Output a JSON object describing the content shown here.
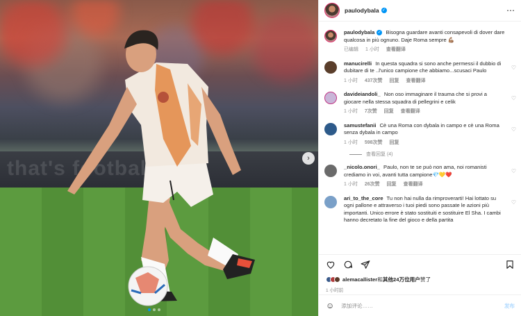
{
  "post": {
    "username": "paulodybala",
    "verified_mark": "✓",
    "more_icon": "more-horizontal-icon"
  },
  "photo": {
    "banner_text": "that's football...",
    "carousel_dots": 3,
    "active_dot": 1,
    "kit_colors": {
      "shirt": "#f2e9df",
      "accent": "#e07a2e",
      "shorts": "#f5f0ea",
      "socks": "#fafafa"
    }
  },
  "caption": {
    "user": "paulodybala",
    "text": "Bisogna guardare avanti consapevoli di dover dare qualcosa in più ognuno. Daje Roma sempre 💪🏽",
    "edited": "已编辑",
    "time": "1 小时",
    "translate": "查看翻译"
  },
  "comments": [
    {
      "user": "manucirelli",
      "text": "In questa squadra si sono anche permessi il dubbio di dubitare di te ..l'unico campione che abbiamo...scusaci Paulo",
      "time": "1 小时",
      "likes": "437次赞",
      "reply": "回复",
      "translate": "查看翻译",
      "avatar_color": "#5a3e2b"
    },
    {
      "user": "davideiandoli_",
      "text": "Non oso immaginare il trauma che si provi a giocare nella stessa squadra di pellegrini e celik",
      "time": "1 小时",
      "likes": "7次赞",
      "reply": "回复",
      "translate": "查看翻译",
      "avatar_color": "#c9b6d8"
    },
    {
      "user": "samustefanii",
      "text": "Cè una Roma con dybala in campo e cè una Roma senza dybala in campo",
      "time": "1 小时",
      "likes": "598次赞",
      "reply": "回复",
      "translate": "",
      "avatar_color": "#2d5a8a"
    },
    {
      "user": "_nicolo.onori_",
      "text": "Paulo, non te se può non ama, noi romanisti crediamo in voi, avanti tutta campione💎💛❤️",
      "time": "1 小时",
      "likes": "26次赞",
      "reply": "回复",
      "translate": "查看翻译",
      "avatar_color": "#6a6a6a"
    },
    {
      "user": "ari_to_the_core",
      "text": "Tu non hai nulla da rimproverarti! Hai lottato su ogni pallone e attraverso i tuoi piedi sono passate le azioni più importanti. Unico errore è stato sostituiti e sostituire El Sha. I cambi hanno decretato la fine del gioco e della partita",
      "time": "",
      "likes": "",
      "reply": "",
      "translate": "",
      "avatar_color": "#7aa0c8"
    }
  ],
  "view_replies": "查看回复 (4)",
  "likes": {
    "user": "alemacallister",
    "connector": "和",
    "others": "其他24万位用户",
    "suffix": "赞了"
  },
  "post_time": "1 小时前",
  "add_comment": {
    "placeholder": "添加评论……",
    "post_label": "发布"
  }
}
